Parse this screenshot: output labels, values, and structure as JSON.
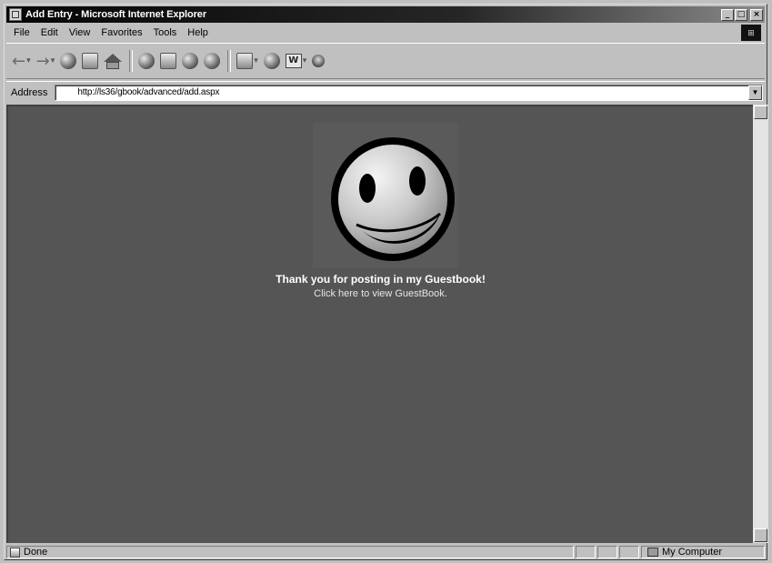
{
  "window": {
    "title": "Add Entry - Microsoft Internet Explorer",
    "minimize": "_",
    "maximize": "□",
    "close": "×"
  },
  "menu": {
    "items": [
      "File",
      "Edit",
      "View",
      "Favorites",
      "Tools",
      "Help"
    ]
  },
  "toolbar": {
    "icons": [
      "back-icon",
      "forward-icon",
      "stop-icon",
      "refresh-icon",
      "home-icon",
      "search-icon",
      "favorites-icon",
      "history-icon",
      "mail-icon",
      "print-icon",
      "edit-icon",
      "discuss-icon",
      "messenger-icon"
    ],
    "back": "←",
    "forward": "→",
    "word_label": "W"
  },
  "address": {
    "label": "Address",
    "url": "http://ls36/gbook/advanced/add.aspx"
  },
  "page": {
    "thanks": "Thank you for posting in my Guestbook!",
    "link": "Click here to view GuestBook."
  },
  "status": {
    "text": "Done",
    "zone": "My Computer"
  },
  "colors": {
    "content_bg": "#555555",
    "title_bar": "#050505",
    "chrome": "#c0c0c0"
  }
}
